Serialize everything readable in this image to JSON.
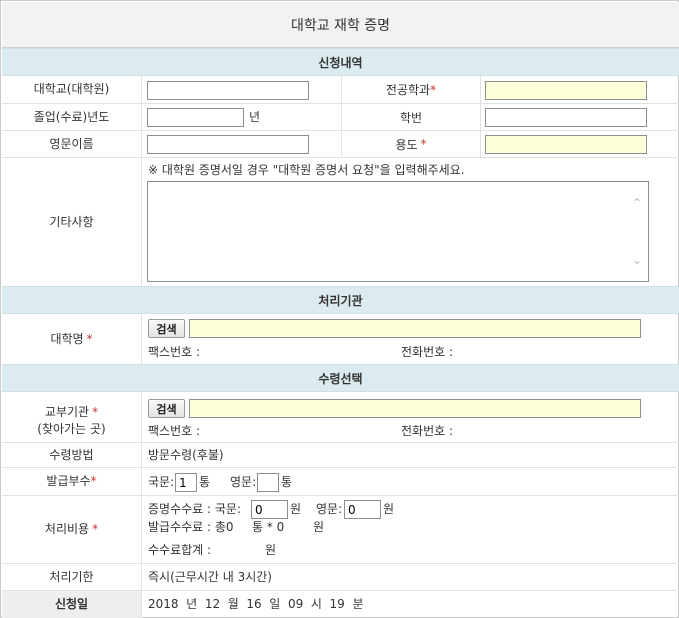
{
  "page_title": "대학교 재학 증명",
  "sections": {
    "apply": "신청내역",
    "process": "처리기관",
    "receive": "수령선택"
  },
  "apply": {
    "university_label": "대학교(대학원)",
    "major_label": "전공학과",
    "graduation_year_label": "졸업(수료)년도",
    "year_unit": "년",
    "student_id_label": "학번",
    "english_name_label": "영문이름",
    "purpose_label": "용도",
    "etc_label": "기타사항",
    "notice": "※ 대학원 증명서일 경우 \"대학원 증명서 요청\"을 입력해주세요.",
    "required_mark": "*"
  },
  "process": {
    "univ_name_label": "대학명",
    "search_label": "검색",
    "fax_label": "팩스번호 :",
    "phone_label": "전화번호 :"
  },
  "receive": {
    "delivery_org_label": "교부기관",
    "delivery_org_sub": "(찾아가는 곳)",
    "search_label": "검색",
    "fax_label": "팩스번호 :",
    "phone_label": "전화번호 :",
    "method_label": "수령방법",
    "method_value": "방문수령(후불)",
    "copies_label": "발급부수",
    "korean_prefix": "국문:",
    "korean_copies": "1",
    "copies_unit": "통",
    "english_prefix": "영문:",
    "english_copies": "",
    "cost_label": "처리비용",
    "cert_fee_prefix": "증명수수료 : 국문:",
    "cert_fee_korean": "0",
    "won": "원",
    "cert_fee_english_prefix": "영문:",
    "cert_fee_english": "0",
    "issue_fee_text": "발급수수료 : 총0",
    "issue_fee_mult": "통 * 0",
    "fee_total_label": "수수료합계 :",
    "deadline_label": "처리기한",
    "deadline_value": "즉시(근무시간 내 3시간)",
    "apply_date_label": "신청일",
    "apply_date_value": "2018  년  12  월  16  일  09  시  19  분"
  }
}
